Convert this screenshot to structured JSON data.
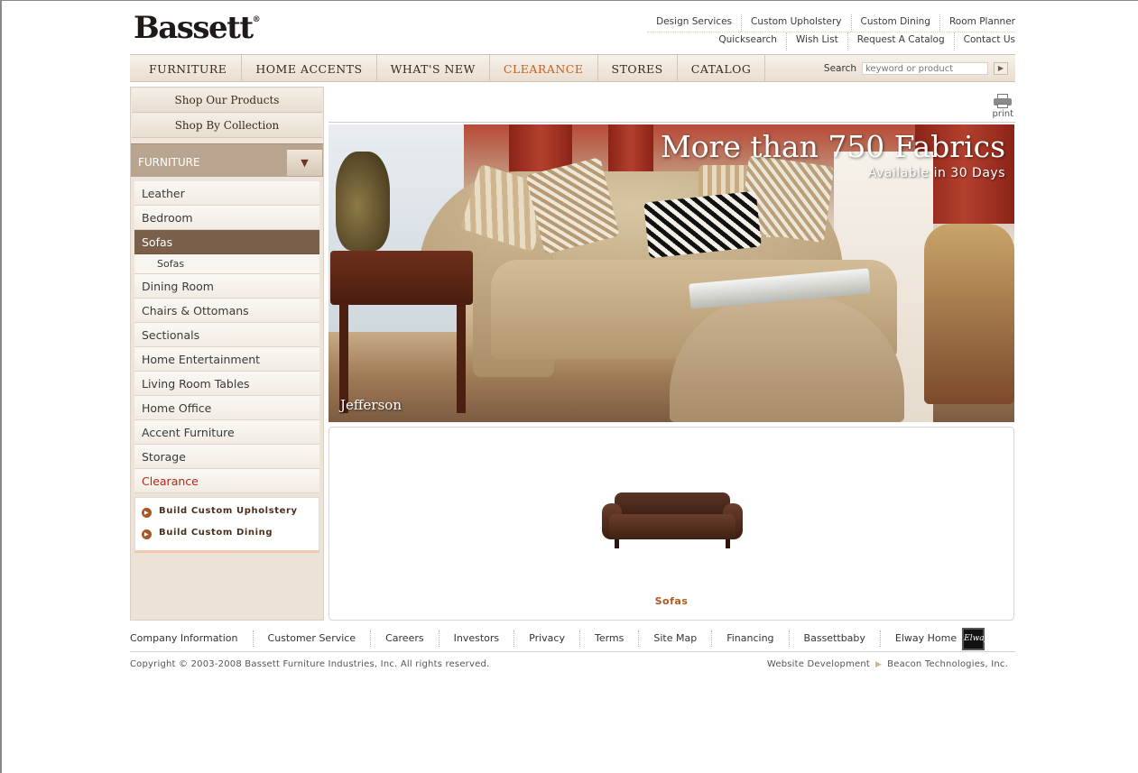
{
  "brand": {
    "logo": "Bassett",
    "logo_mark": "®"
  },
  "top_links": {
    "row1": [
      "Design Services",
      "Custom Upholstery",
      "Custom Dining",
      "Room Planner"
    ],
    "row2": [
      "Quicksearch",
      "Wish List",
      "Request A Catalog",
      "Contact Us"
    ]
  },
  "nav": {
    "items": [
      "FURNITURE",
      "HOME ACCENTS",
      "WHAT'S NEW",
      "CLEARANCE",
      "STORES",
      "CATALOG"
    ],
    "highlight_color": "#c4621e"
  },
  "search": {
    "label": "Search",
    "placeholder": "keyword or product",
    "go_icon": "play-arrow-icon"
  },
  "sidebar": {
    "shop_buttons": [
      "Shop Our Products",
      "Shop By Collection"
    ],
    "category_header": "FURNITURE",
    "categories": [
      "Leather",
      "Bedroom",
      "Sofas",
      "Sofas",
      "Dining Room",
      "Chairs & Ottomans",
      "Sectionals",
      "Home Entertainment",
      "Living Room Tables",
      "Home Office",
      "Accent Furniture",
      "Storage",
      "Clearance"
    ],
    "active_category": "Sofas",
    "build_links": [
      "Build Custom Upholstery",
      "Build Custom Dining"
    ]
  },
  "print": {
    "label": "print"
  },
  "hero": {
    "headline": "More than 750 Fabrics",
    "subheadline": "Available in 30 Days",
    "caption": "Jefferson"
  },
  "products": {
    "label": "Sofas"
  },
  "footer": {
    "links": [
      "Company Information",
      "Customer Service",
      "Careers",
      "Investors",
      "Privacy",
      "Terms",
      "Site Map",
      "Financing",
      "Bassettbaby",
      "Elway Home"
    ],
    "elway_badge": "Elway",
    "copyright": "Copyright © 2003-2008 Bassett Furniture Industries, Inc. All rights reserved.",
    "dev_label": "Website Development",
    "dev_company": "Beacon Technologies, Inc."
  },
  "colors": {
    "accent": "#c4621e",
    "active_bg": "#7a5f4a",
    "clearance_red": "#b0281c"
  }
}
